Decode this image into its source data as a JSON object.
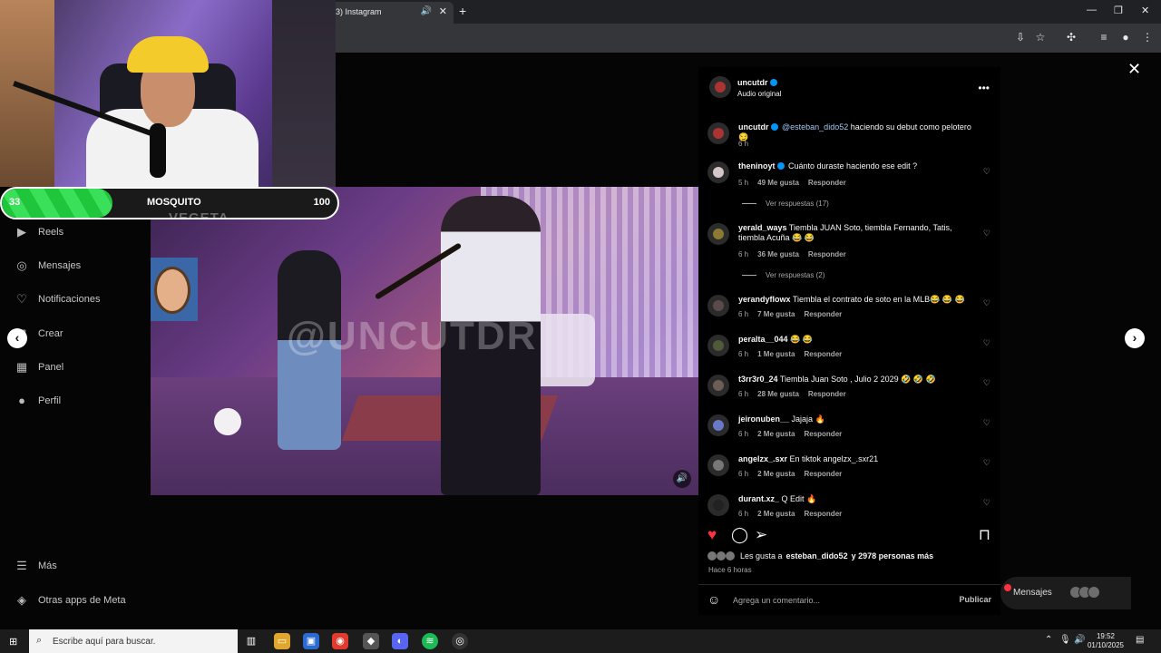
{
  "browser": {
    "tab_title": "3) Instagram",
    "tab_mute_icon": "speaker-icon",
    "tab_close_icon": "close-icon",
    "new_tab_icon": "plus-icon",
    "window_controls": [
      "minimize-icon",
      "restore-icon",
      "close-icon"
    ]
  },
  "overlay": {
    "progress_left": "33",
    "progress_center": "MOSQUITO",
    "progress_right": "100",
    "progress_subtitle": "VEGETA",
    "progress_value": 0.33
  },
  "video": {
    "watermark": "@UNCUTDR"
  },
  "sidebar": {
    "items": [
      {
        "label": "Reels",
        "icon": "reels-icon"
      },
      {
        "label": "Mensajes",
        "icon": "messenger-icon"
      },
      {
        "label": "Notificaciones",
        "icon": "heart-icon"
      },
      {
        "label": "Crear",
        "icon": "plus-square-icon"
      },
      {
        "label": "Panel",
        "icon": "chart-icon"
      },
      {
        "label": "Perfil",
        "icon": "avatar-icon"
      }
    ],
    "bottom": [
      {
        "label": "Más",
        "icon": "menu-icon"
      },
      {
        "label": "Otras apps de Meta",
        "icon": "meta-icon"
      }
    ]
  },
  "post": {
    "author": "uncutdr",
    "audio": "Audio original",
    "caption_author": "uncutdr",
    "caption_mention": "@esteban_dido52",
    "caption_text": "haciendo su debut como pelotero 😏",
    "caption_time": "6 h",
    "likes_prefix": "Les gusta a",
    "likes_user": "esteban_dido52",
    "likes_suffix": "y 2978 personas más",
    "posted": "Hace 6 horas",
    "comment_placeholder": "Agrega un comentario...",
    "publish": "Publicar"
  },
  "comments": [
    {
      "user": "theninoyt",
      "verified": true,
      "text": "Cuánto duraste haciendo ese edit ?",
      "time": "5 h",
      "likes": "49 Me gusta",
      "reply": "Responder",
      "replies": "Ver respuestas (17)"
    },
    {
      "user": "yerald_ways",
      "verified": false,
      "text": "Tiembla JUAN Soto, tiembla Fernando, Tatis, tiembla Acuña 😂 😂",
      "time": "6 h",
      "likes": "36 Me gusta",
      "reply": "Responder",
      "replies": "Ver respuestas (2)"
    },
    {
      "user": "yerandyflowx",
      "verified": false,
      "text": "Tiembla el contrato de soto en la MLB😂 😂 😂",
      "time": "6 h",
      "likes": "7 Me gusta",
      "reply": "Responder",
      "replies": ""
    },
    {
      "user": "peralta__044",
      "verified": false,
      "text": "😂 😂",
      "time": "6 h",
      "likes": "1 Me gusta",
      "reply": "Responder",
      "replies": ""
    },
    {
      "user": "t3rr3r0_24",
      "verified": false,
      "text": "Tiembla Juan Soto , Julio 2 2029 🤣 🤣 🤣",
      "time": "6 h",
      "likes": "28 Me gusta",
      "reply": "Responder",
      "replies": ""
    },
    {
      "user": "jeironuben__",
      "verified": false,
      "text": "Jajaja 🔥",
      "time": "6 h",
      "likes": "2 Me gusta",
      "reply": "Responder",
      "replies": ""
    },
    {
      "user": "angelzx_.sxr",
      "verified": false,
      "text": "En tiktok angelzx_.sxr21",
      "time": "6 h",
      "likes": "2 Me gusta",
      "reply": "Responder",
      "replies": ""
    },
    {
      "user": "durant.xz_",
      "verified": false,
      "text": "Q Edit 🔥",
      "time": "6 h",
      "likes": "2 Me gusta",
      "reply": "Responder",
      "replies": ""
    }
  ],
  "messages_pill": {
    "label": "Mensajes"
  },
  "taskbar": {
    "search_placeholder": "Escribe aquí para buscar.",
    "time": "19:52",
    "date": "01/10/2025"
  },
  "colors": {
    "accent_like": "#ff3040",
    "verified": "#0095f6",
    "progress_green": "#1fc63c"
  }
}
